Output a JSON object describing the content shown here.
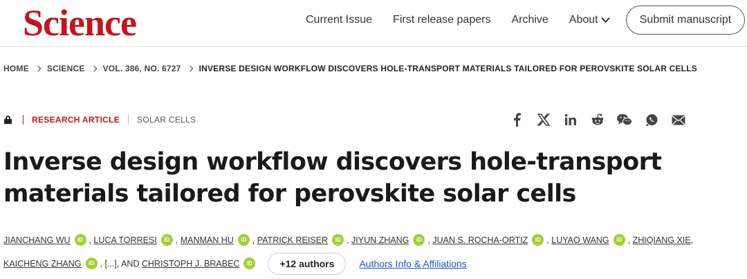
{
  "header": {
    "logo": "Science",
    "nav": [
      "Current Issue",
      "First release papers",
      "Archive",
      "About"
    ],
    "submit_label": "Submit manuscript"
  },
  "breadcrumb": [
    "HOME",
    "SCIENCE",
    "VOL. 386, NO. 6727",
    "INVERSE DESIGN WORKFLOW DISCOVERS HOLE-TRANSPORT MATERIALS TAILORED FOR PEROVSKITE SOLAR CELLS"
  ],
  "article": {
    "type": "RESEARCH ARTICLE",
    "section": "SOLAR CELLS",
    "title_line1": "Inverse design workflow discovers hole-transport",
    "title_line2": "materials tailored for perovskite solar cells"
  },
  "share_icons": [
    "facebook-icon",
    "x-icon",
    "linkedin-icon",
    "reddit-icon",
    "wechat-icon",
    "whatsapp-icon",
    "email-icon"
  ],
  "authors": {
    "list": [
      "JIANCHANG WU",
      "LUCA TORRESI",
      "MANMAN HU",
      "PATRICK REISER",
      "JIYUN ZHANG",
      "JUAN S. ROCHA-ORTIZ",
      "LUYAO WANG",
      "ZHIQIANG XIE"
    ],
    "row2_first": "KAICHENG ZHANG",
    "ellipsis": ", [...], AND",
    "last": "CHRISTOPH J. BRABEC",
    "orcid_label": "iD",
    "more_label": "+12 authors",
    "affiliations_label": "Authors Info & Affiliations"
  },
  "colors": {
    "brand": "#c4151c",
    "orcid": "#a6ce39",
    "link": "#1b57c0"
  }
}
